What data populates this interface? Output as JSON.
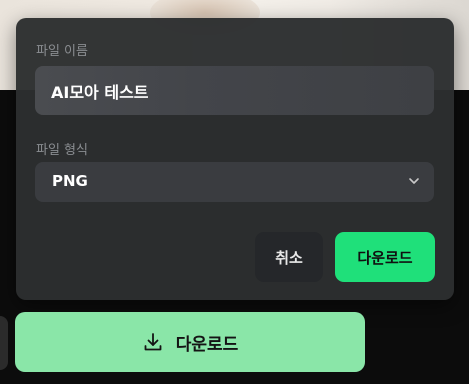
{
  "dialog": {
    "file_name_label": "파일 이름",
    "file_name_value": "AI모아 테스트",
    "file_format_label": "파일 형식",
    "file_format_value": "PNG",
    "cancel_label": "취소",
    "confirm_label": "다운로드"
  },
  "main": {
    "download_label": "다운로드"
  },
  "icons": {
    "format_chevron": "chevron-down-icon",
    "download": "download-icon"
  },
  "colors": {
    "dialog_bg": "#2c2e30",
    "accent_green": "#1fe07a",
    "download_button_bg": "#8ae6a8"
  }
}
